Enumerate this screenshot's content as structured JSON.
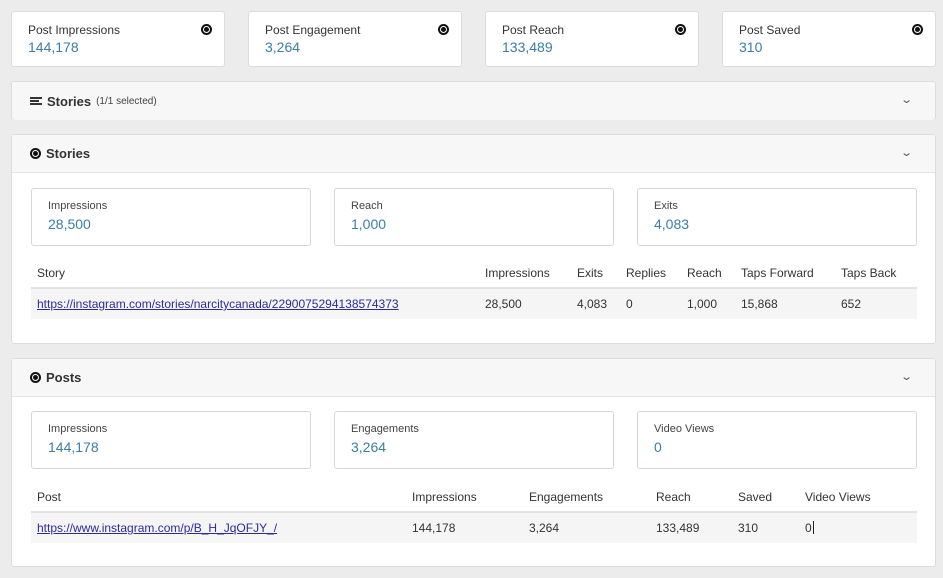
{
  "top_cards": [
    {
      "label": "Post Impressions",
      "value": "144,178"
    },
    {
      "label": "Post Engagement",
      "value": "3,264"
    },
    {
      "label": "Post Reach",
      "value": "133,489"
    },
    {
      "label": "Post Saved",
      "value": "310"
    }
  ],
  "stories_selector": {
    "title": "Stories",
    "subtitle": "(1/1 selected)"
  },
  "stories": {
    "title": "Stories",
    "metrics": [
      {
        "label": "Impressions",
        "value": "28,500"
      },
      {
        "label": "Reach",
        "value": "1,000"
      },
      {
        "label": "Exits",
        "value": "4,083"
      }
    ],
    "columns": [
      "Story",
      "Impressions",
      "Exits",
      "Replies",
      "Reach",
      "Taps Forward",
      "Taps Back"
    ],
    "rows": [
      [
        "https://instagram.com/stories/narcitycanada/2290075294138574373",
        "28,500",
        "4,083",
        "0",
        "1,000",
        "15,868",
        "652"
      ]
    ]
  },
  "posts": {
    "title": "Posts",
    "metrics": [
      {
        "label": "Impressions",
        "value": "144,178"
      },
      {
        "label": "Engagements",
        "value": "3,264"
      },
      {
        "label": "Video Views",
        "value": "0"
      }
    ],
    "columns": [
      "Post",
      "Impressions",
      "Engagements",
      "Reach",
      "Saved",
      "Video Views"
    ],
    "rows": [
      [
        "https://www.instagram.com/p/B_H_JqOFJY_/",
        "144,178",
        "3,264",
        "133,489",
        "310",
        "0"
      ]
    ]
  },
  "icons": {
    "instagram": "instagram-icon",
    "list": "list-icon",
    "chevron": "chevron-down-icon"
  }
}
